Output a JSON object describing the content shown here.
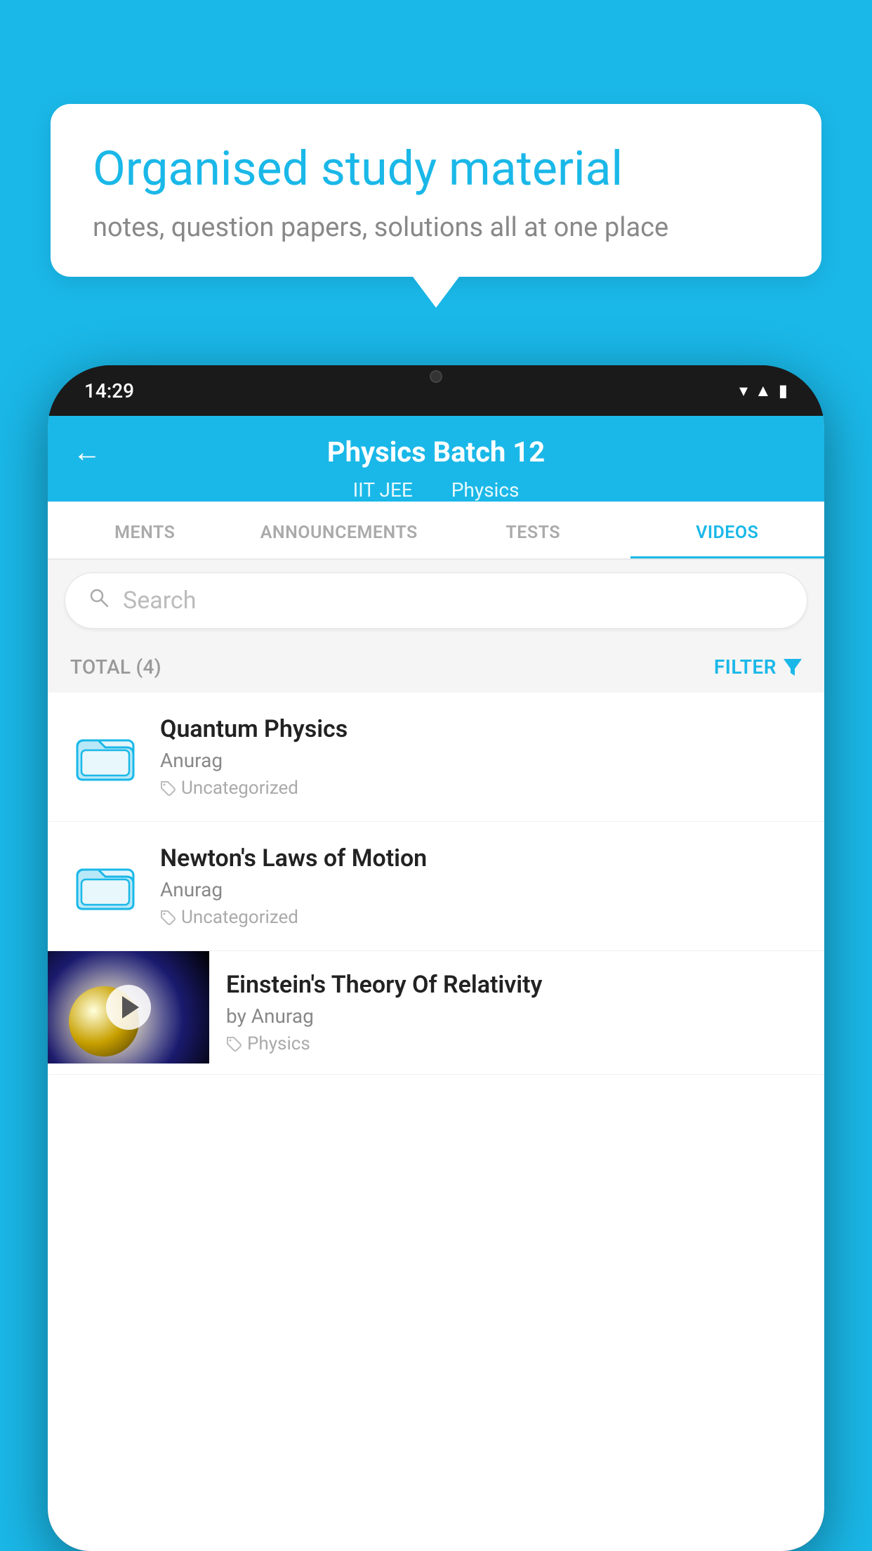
{
  "background_color": "#1ab8e8",
  "speech_bubble": {
    "title": "Organised study material",
    "subtitle": "notes, question papers, solutions all at one place"
  },
  "phone": {
    "time": "14:29",
    "header": {
      "title": "Physics Batch 12",
      "subtitle1": "IIT JEE",
      "subtitle2": "Physics"
    },
    "tabs": [
      {
        "label": "MENTS",
        "active": false
      },
      {
        "label": "ANNOUNCEMENTS",
        "active": false
      },
      {
        "label": "TESTS",
        "active": false
      },
      {
        "label": "VIDEOS",
        "active": true
      }
    ],
    "search_placeholder": "Search",
    "filter": {
      "total_label": "TOTAL (4)",
      "filter_label": "FILTER"
    },
    "videos": [
      {
        "title": "Quantum Physics",
        "author": "Anurag",
        "tag": "Uncategorized",
        "has_thumbnail": false
      },
      {
        "title": "Newton's Laws of Motion",
        "author": "Anurag",
        "tag": "Uncategorized",
        "has_thumbnail": false
      },
      {
        "title": "Einstein's Theory Of Relativity",
        "author": "by Anurag",
        "tag": "Physics",
        "has_thumbnail": true
      }
    ]
  }
}
